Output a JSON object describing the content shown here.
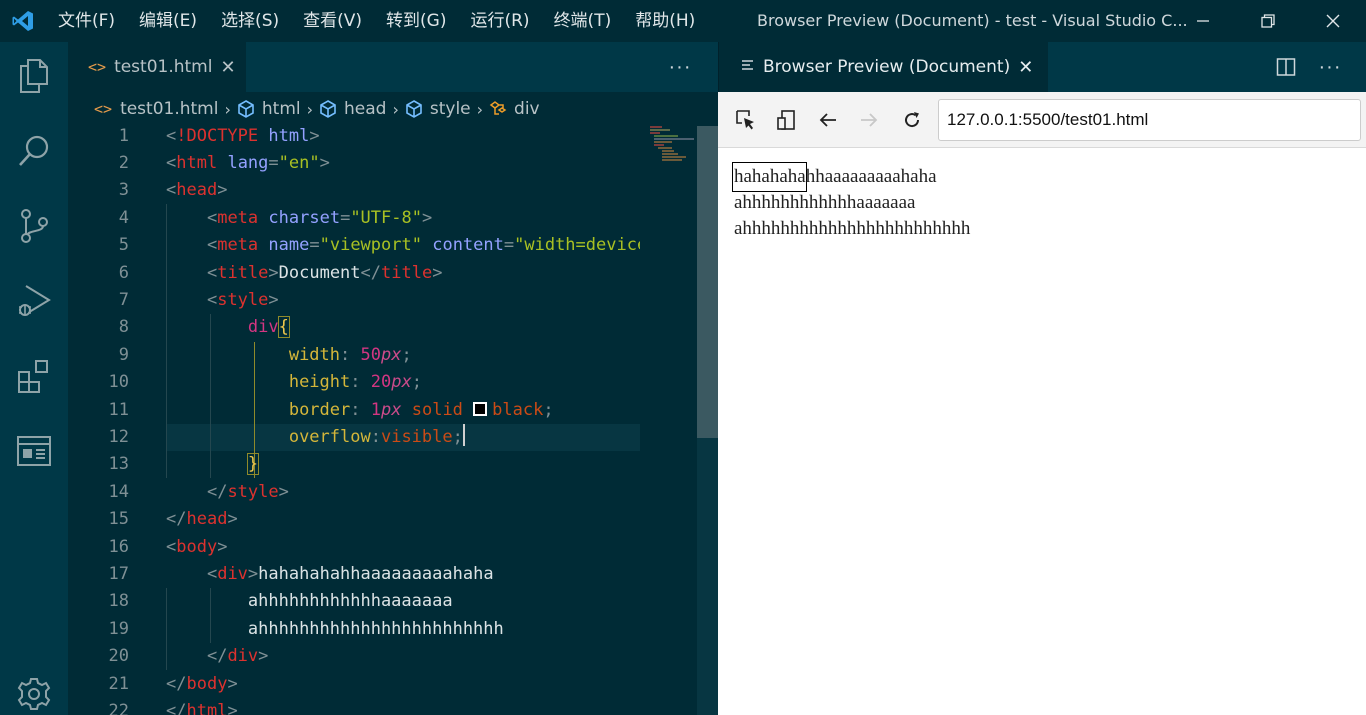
{
  "menu": [
    "文件(F)",
    "编辑(E)",
    "选择(S)",
    "查看(V)",
    "转到(G)",
    "运行(R)",
    "终端(T)",
    "帮助(H)"
  ],
  "window_title": "Browser Preview (Document) - test - Visual Studio C...",
  "editor_tab": {
    "icon": "<>",
    "label": "test01.html"
  },
  "breadcrumb": [
    "test01.html",
    "html",
    "head",
    "style",
    "div"
  ],
  "line_numbers": [
    "1",
    "2",
    "3",
    "4",
    "5",
    "6",
    "7",
    "8",
    "9",
    "10",
    "11",
    "12",
    "13",
    "14",
    "15",
    "16",
    "17",
    "18",
    "19",
    "20",
    "21",
    "22"
  ],
  "code": {
    "l1": "<!DOCTYPE html>",
    "l17_text": "hahahahahhaaaaaaaaahaha",
    "l18_text": "ahhhhhhhhhhhhaaaaaaa",
    "l19_text": "ahhhhhhhhhhhhhhhhhhhhhhhh"
  },
  "preview_tab": {
    "label": "Browser Preview (Document)"
  },
  "url": "127.0.0.1:5500/test01.html",
  "preview_text": {
    "line1": "hahahahahhaaaaaaaaahaha",
    "line2": "ahhhhhhhhhhhhaaaaaaa",
    "line3": "ahhhhhhhhhhhhhhhhhhhhhhhh"
  },
  "colors": {
    "activitybar": "#003847",
    "editor_bg": "#002b36",
    "titlebar": "#002b36",
    "accent_logo": "#2f9ee6"
  }
}
